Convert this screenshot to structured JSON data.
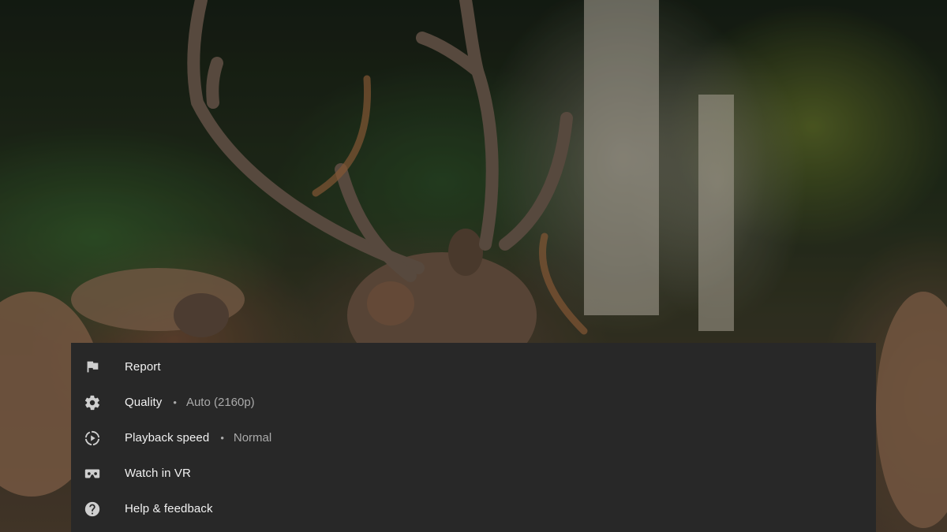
{
  "menu": {
    "items": [
      {
        "label": "Report",
        "value": "",
        "icon": "flag-icon"
      },
      {
        "label": "Quality",
        "value": "Auto (2160p)",
        "icon": "gear-icon"
      },
      {
        "label": "Playback speed",
        "value": "Normal",
        "icon": "playback-speed-icon"
      },
      {
        "label": "Watch in VR",
        "value": "",
        "icon": "vr-headset-icon"
      },
      {
        "label": "Help & feedback",
        "value": "",
        "icon": "help-icon"
      }
    ],
    "separator": "•"
  },
  "colors": {
    "panel_background": "#282828",
    "label_text": "#f1f1f1",
    "value_text": "#aaaaaa",
    "icon": "#cfcfcf"
  }
}
